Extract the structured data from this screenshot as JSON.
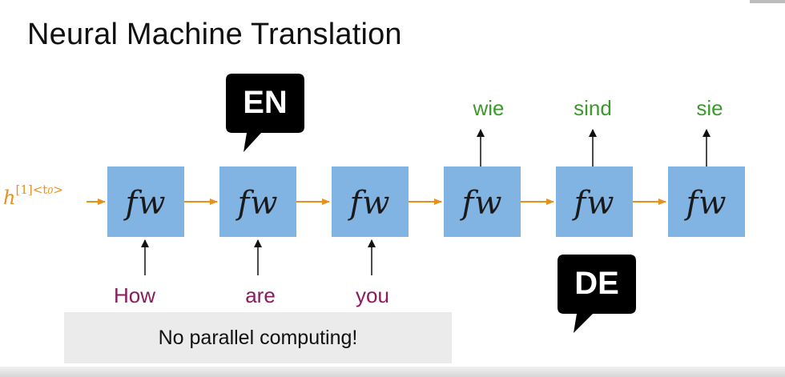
{
  "slide": {
    "title": "Neural Machine Translation",
    "hidden_state": {
      "base": "h",
      "sup_index": "[1]",
      "sup_time": "<t",
      "sup_sub": "0",
      "sup_close": ">"
    },
    "cell_label": "fw",
    "input_words": [
      "How",
      "are",
      "you"
    ],
    "output_words": [
      "wie",
      "sind",
      "sie"
    ],
    "source_lang": "EN",
    "target_lang": "DE",
    "note": "No parallel computing!"
  },
  "colors": {
    "cell_fill": "#82b4e3",
    "arrow_orange": "#e8901e",
    "input_word": "#8b1a5b",
    "output_word": "#3a9a2a",
    "bubble": "#000000",
    "note_background": "#ebebeb"
  }
}
